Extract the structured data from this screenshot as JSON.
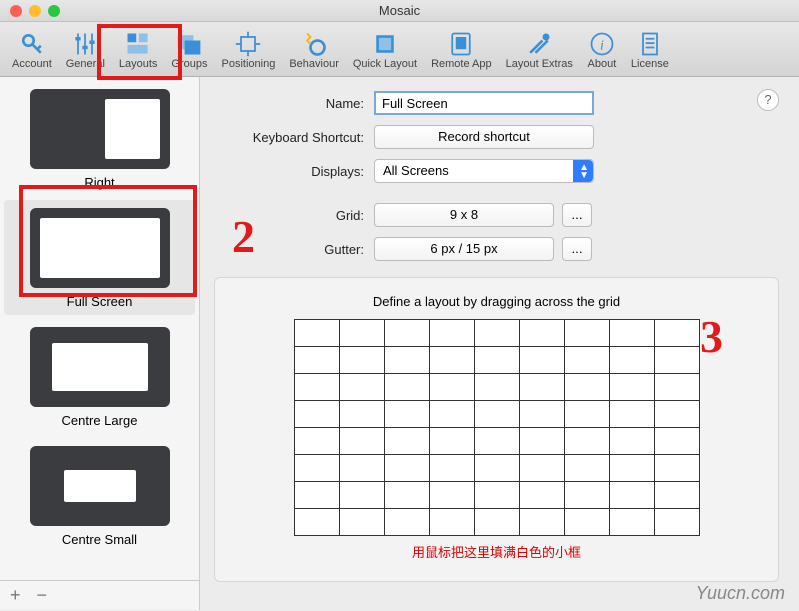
{
  "titlebar": {
    "title": "Mosaic"
  },
  "toolbar": {
    "items": [
      {
        "label": "Account",
        "icon": "key"
      },
      {
        "label": "General",
        "icon": "sliders"
      },
      {
        "label": "Layouts",
        "icon": "layouts"
      },
      {
        "label": "Groups",
        "icon": "groups"
      },
      {
        "label": "Positioning",
        "icon": "positioning"
      },
      {
        "label": "Behaviour",
        "icon": "behaviour"
      },
      {
        "label": "Quick Layout",
        "icon": "quick"
      },
      {
        "label": "Remote App",
        "icon": "remote"
      },
      {
        "label": "Layout Extras",
        "icon": "extras"
      },
      {
        "label": "About",
        "icon": "about"
      },
      {
        "label": "License",
        "icon": "license"
      }
    ]
  },
  "sidebar": {
    "items": [
      {
        "label": "Right",
        "thumb": "right",
        "selected": false
      },
      {
        "label": "Full Screen",
        "thumb": "full",
        "selected": true
      },
      {
        "label": "Centre Large",
        "thumb": "centerL",
        "selected": false
      },
      {
        "label": "Centre Small",
        "thumb": "centerS",
        "selected": false
      }
    ],
    "add_label": "+",
    "remove_label": "−"
  },
  "form": {
    "name_label": "Name:",
    "name_value": "Full Screen",
    "shortcut_label": "Keyboard Shortcut:",
    "shortcut_button": "Record shortcut",
    "displays_label": "Displays:",
    "displays_value": "All Screens",
    "grid_label": "Grid:",
    "grid_value": "9 x 8",
    "gutter_label": "Gutter:",
    "gutter_value": "6 px / 15 px",
    "more_button": "...",
    "help_label": "?"
  },
  "panel": {
    "title": "Define a layout by dragging across the grid",
    "grid_cols": 9,
    "grid_rows": 8,
    "caption": "用鼠标把这里填满白色的小框"
  },
  "watermark": "Yuucn.com",
  "annotations": {
    "n2": "2",
    "n3": "3"
  }
}
